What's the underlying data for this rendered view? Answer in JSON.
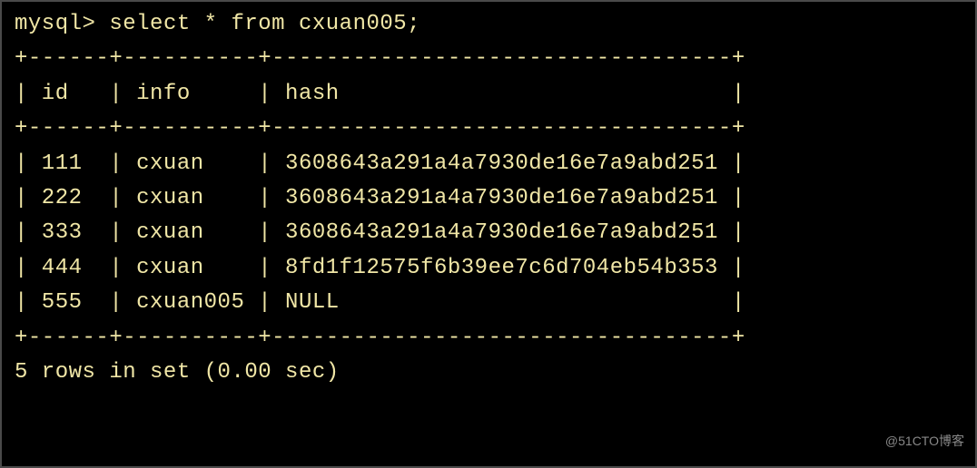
{
  "terminal": {
    "prompt": "mysql> ",
    "command": "select * from cxuan005;",
    "border_top": "+------+----------+----------------------------------+",
    "header": "| id   | info     | hash                             |",
    "border_mid": "+------+----------+----------------------------------+",
    "rows": [
      "| 111  | cxuan    | 3608643a291a4a7930de16e7a9abd251 |",
      "| 222  | cxuan    | 3608643a291a4a7930de16e7a9abd251 |",
      "| 333  | cxuan    | 3608643a291a4a7930de16e7a9abd251 |",
      "| 444  | cxuan    | 8fd1f12575f6b39ee7c6d704eb54b353 |",
      "| 555  | cxuan005 | NULL                             |"
    ],
    "border_bottom": "+------+----------+----------------------------------+",
    "footer": "5 rows in set (0.00 sec)"
  },
  "chart_data": {
    "type": "table",
    "columns": [
      "id",
      "info",
      "hash"
    ],
    "rows": [
      {
        "id": 111,
        "info": "cxuan",
        "hash": "3608643a291a4a7930de16e7a9abd251"
      },
      {
        "id": 222,
        "info": "cxuan",
        "hash": "3608643a291a4a7930de16e7a9abd251"
      },
      {
        "id": 333,
        "info": "cxuan",
        "hash": "3608643a291a4a7930de16e7a9abd251"
      },
      {
        "id": 444,
        "info": "cxuan",
        "hash": "8fd1f12575f6b39ee7c6d704eb54b353"
      },
      {
        "id": 555,
        "info": "cxuan005",
        "hash": null
      }
    ]
  },
  "watermark": "@51CTO博客"
}
